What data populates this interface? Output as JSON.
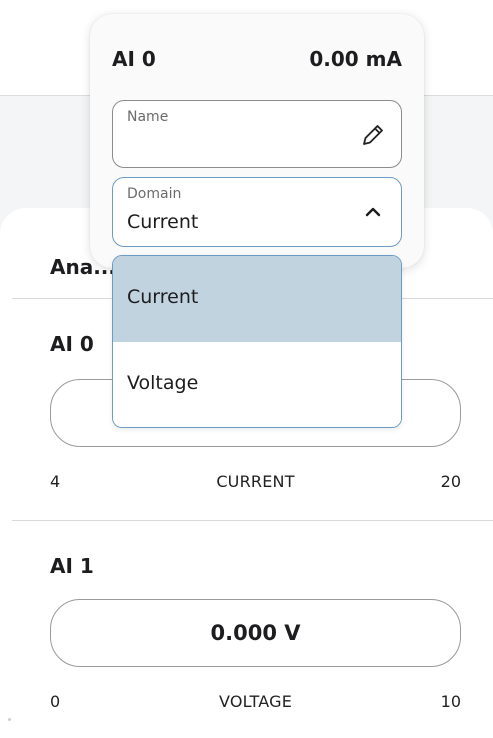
{
  "colors": {
    "background": "#f4f5f6",
    "selected_option": "#c2d3e0",
    "focus_border": "#6d9bc8"
  },
  "section": {
    "title": "Ana..."
  },
  "channels": [
    {
      "label": "AI 0",
      "value": "",
      "scale_min": "4",
      "scale_label": "CURRENT",
      "scale_max": "20"
    },
    {
      "label": "AI 1",
      "value": "0.000 V",
      "scale_min": "0",
      "scale_label": "VOLTAGE",
      "scale_max": "10"
    }
  ],
  "popover": {
    "channel": "AI 0",
    "reading": "0.00 mA",
    "name_field": {
      "label": "Name",
      "value": "",
      "icon": "pencil-icon"
    },
    "domain_field": {
      "label": "Domain",
      "value": "Current",
      "icon": "chevron-up-icon"
    },
    "options": [
      {
        "label": "Current",
        "selected": true
      },
      {
        "label": "Voltage",
        "selected": false
      }
    ]
  }
}
